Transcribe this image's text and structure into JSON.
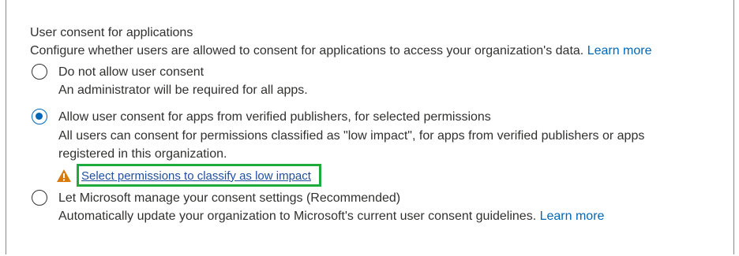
{
  "section": {
    "title": "User consent for applications",
    "description": "Configure whether users are allowed to consent for applications to access your organization's data.",
    "learn_more": "Learn more"
  },
  "options": [
    {
      "label": "Do not allow user consent",
      "description": "An administrator will be required for all apps.",
      "selected": false
    },
    {
      "label": "Allow user consent for apps from verified publishers, for selected permissions",
      "description_line1": "All users can consent for permissions classified as \"low impact\", for apps from verified publishers or apps",
      "description_line2": "registered in this organization.",
      "warning_icon": "warning-icon",
      "action_link": "Select permissions to classify as low impact",
      "selected": true
    },
    {
      "label": "Let Microsoft manage your consent settings (Recommended)",
      "description": "Automatically update your organization to Microsoft's current user consent guidelines.",
      "learn_more": "Learn more",
      "selected": false
    }
  ],
  "colors": {
    "accent": "#0067b8",
    "warning": "#d97a0b",
    "highlight": "#1faa3c"
  }
}
